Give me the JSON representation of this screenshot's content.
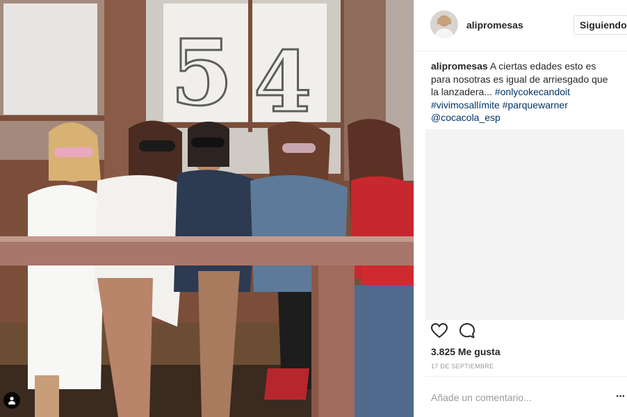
{
  "post": {
    "username": "alipromesas",
    "follow_label": "Siguiendo",
    "caption": {
      "username": "alipromesas",
      "text": "A ciertas edades esto es para nosotras es igual de arriesgado que la lanzadera...",
      "hashtags": [
        "#onlycokecandoit",
        "#vivimosallímite",
        "#parquewarner"
      ],
      "mention": "@cocacola_esp"
    },
    "likes": "3.825 Me gusta",
    "date": "17 DE SEPTIEMBRE",
    "comment_placeholder": "Añade un comentario...",
    "more_label": "···"
  },
  "icons": {
    "like": "heart-outline-icon",
    "comment": "speech-bubble-icon",
    "user_tag": "person-tag-icon"
  },
  "colors": {
    "link": "#003569",
    "text": "#262626",
    "muted": "#999999",
    "border": "#efefef"
  }
}
